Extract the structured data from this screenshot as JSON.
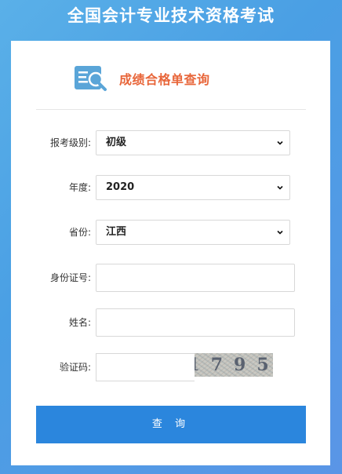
{
  "page": {
    "title": "全国会计专业技术资格考试"
  },
  "card": {
    "heading": "成绩合格单查询",
    "icon": "document-search-icon"
  },
  "form": {
    "level": {
      "label": "报考级别:",
      "value": "初级"
    },
    "year": {
      "label": "年度:",
      "value": "2020"
    },
    "province": {
      "label": "省份:",
      "value": "江西"
    },
    "id_number": {
      "label": "身份证号:",
      "value": "",
      "placeholder": ""
    },
    "name": {
      "label": "姓名:",
      "value": "",
      "placeholder": ""
    },
    "captcha": {
      "label": "验证码:",
      "value": "",
      "placeholder": "",
      "image_text": "1795"
    },
    "submit_label": "查 询"
  },
  "colors": {
    "accent": "#2b86dd",
    "heading": "#e8663a",
    "icon": "#5aa5d8"
  }
}
